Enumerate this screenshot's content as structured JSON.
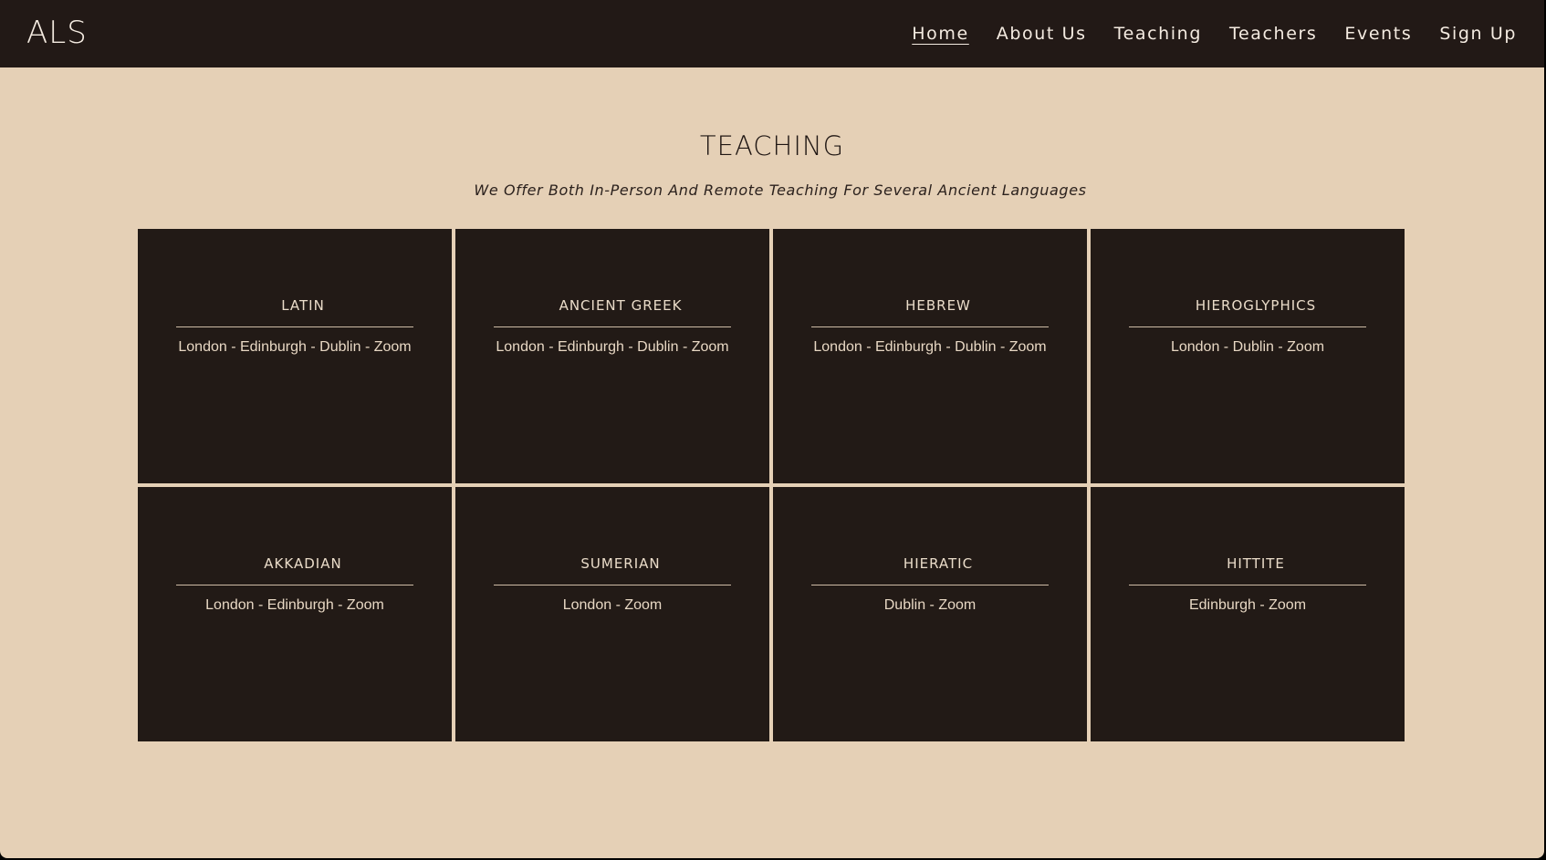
{
  "header": {
    "logo": "ALS",
    "nav": [
      {
        "label": "Home",
        "active": true
      },
      {
        "label": "About Us",
        "active": false
      },
      {
        "label": "Teaching",
        "active": false
      },
      {
        "label": "Teachers",
        "active": false
      },
      {
        "label": "Events",
        "active": false
      },
      {
        "label": "Sign Up",
        "active": false
      }
    ]
  },
  "main": {
    "title": "TEACHING",
    "subtitle": "We Offer Both In-Person And Remote Teaching For Several Ancient Languages",
    "courses": [
      {
        "name": "LATIN",
        "locations": "London - Edinburgh - Dublin - Zoom"
      },
      {
        "name": "ANCIENT GREEK",
        "locations": "London - Edinburgh - Dublin - Zoom"
      },
      {
        "name": "HEBREW",
        "locations": "London - Edinburgh - Dublin - Zoom"
      },
      {
        "name": "HIEROGLYPHICS",
        "locations": "London - Dublin - Zoom"
      },
      {
        "name": "AKKADIAN",
        "locations": "London - Edinburgh - Zoom"
      },
      {
        "name": "SUMERIAN",
        "locations": "London - Zoom"
      },
      {
        "name": "HIERATIC",
        "locations": "Dublin - Zoom"
      },
      {
        "name": "HITTITE",
        "locations": "Edinburgh - Zoom"
      }
    ]
  },
  "colors": {
    "page_background": "#e5d0b6",
    "dark": "#221a16",
    "light_text": "#eadcc9"
  }
}
